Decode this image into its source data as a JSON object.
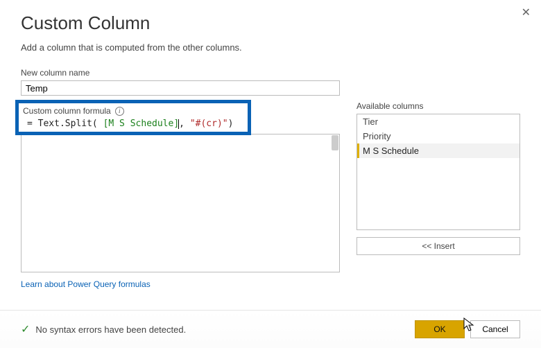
{
  "window": {
    "title": "Custom Column",
    "subtitle": "Add a column that is computed from the other columns."
  },
  "fields": {
    "name_label": "New column name",
    "name_value": "Temp",
    "formula_label": "Custom column formula",
    "formula_prefix": "= ",
    "formula_func": "Text.Split(",
    "formula_col": " [M S Schedule]",
    "formula_mid": ", ",
    "formula_str": "\"#(cr)\"",
    "formula_close": ")"
  },
  "available": {
    "label": "Available columns",
    "items": [
      "Tier",
      "Priority",
      "M S Schedule"
    ],
    "selected_index": 2,
    "insert_label": "<< Insert"
  },
  "link": "Learn about Power Query formulas",
  "status": {
    "text": "No syntax errors have been detected."
  },
  "buttons": {
    "ok": "OK",
    "cancel": "Cancel"
  }
}
